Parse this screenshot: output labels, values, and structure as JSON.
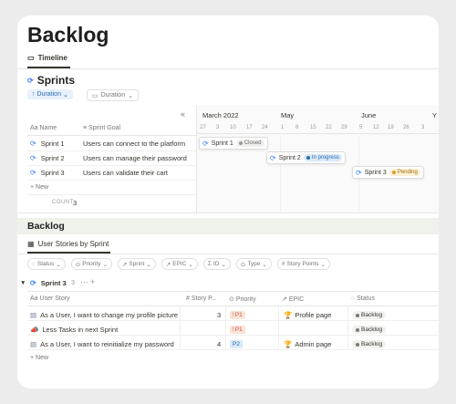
{
  "page": {
    "title": "Backlog",
    "tab_label": "Timeline"
  },
  "sprints": {
    "title": "Sprints",
    "sort_pill": "Duration",
    "view_pill": "Duration",
    "collapse_glyph": "«",
    "col_name": "Name",
    "col_goal": "Sprint Goal",
    "months": [
      "March 2022",
      "May",
      "June",
      "Y"
    ],
    "ticks": [
      "27",
      "3",
      "10",
      "17",
      "24",
      "1",
      "8",
      "15",
      "22",
      "29",
      "5",
      "12",
      "19",
      "26",
      "3"
    ],
    "rows": [
      {
        "name": "Sprint 1",
        "goal": "Users can connect to the platform",
        "status": "Closed"
      },
      {
        "name": "Sprint 2",
        "goal": "Users can manage their password",
        "status": "In progress"
      },
      {
        "name": "Sprint 3",
        "goal": "Users can validate their cart",
        "status": "Pending"
      }
    ],
    "new_label": "New",
    "count_label": "COUNT",
    "count_value": "3"
  },
  "backlog": {
    "title": "Backlog",
    "view_tab": "User Stories by Sprint",
    "filters": [
      "Status",
      "Priority",
      "Sprint",
      "EPIC",
      "ID",
      "Type",
      "Story Points"
    ],
    "group": {
      "name": "Sprint 3",
      "count": "3"
    },
    "columns": {
      "story": "User Story",
      "points": "Story P...",
      "priority": "Priority",
      "epic": "EPIC",
      "status": "Status"
    },
    "rows": [
      {
        "story": "As a User, I want to change my profile picture",
        "points": "3",
        "priority": "P1",
        "epic": "Profile page",
        "status": "Backlog"
      },
      {
        "story": "Less Tasks in next Sprint",
        "points": "",
        "priority": "P1",
        "epic": "",
        "status": "Backlog"
      },
      {
        "story": "As a User, I want to reinitialize my password",
        "points": "4",
        "priority": "P2",
        "epic": "Admin page",
        "status": "Backlog"
      }
    ],
    "new_label": "New"
  },
  "colors": {
    "accent": "#2b6cb0",
    "closed_dot": "#9b9a97",
    "in_progress_bg": "#dbe9f7",
    "pending_bg": "#fbf0d5",
    "p1_bg": "#fbe4d6",
    "p2_bg": "#dbe9f7"
  }
}
